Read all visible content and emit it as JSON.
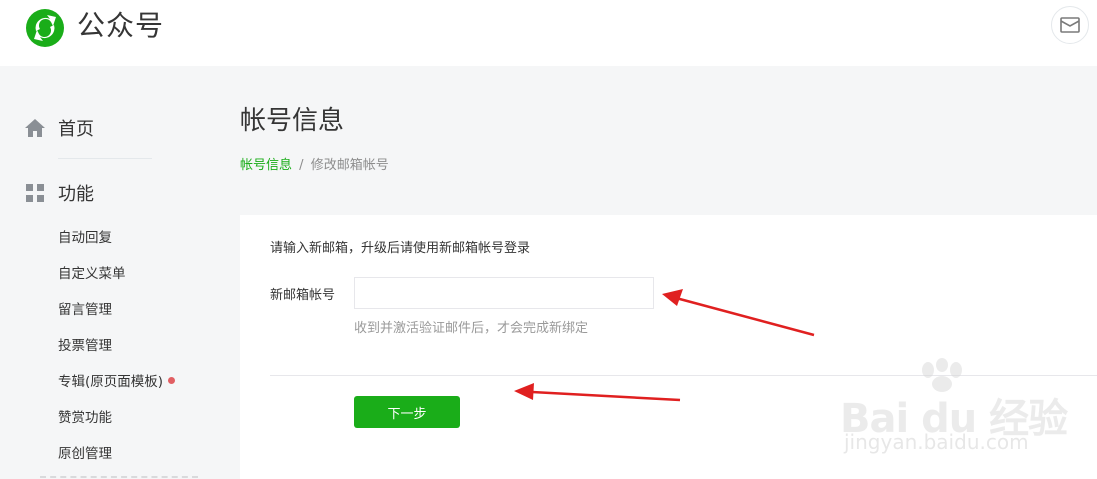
{
  "header": {
    "logo_text": "公众号",
    "mail_icon": "mail-icon"
  },
  "sidebar": {
    "home_label": "首页",
    "home_icon": "home-icon",
    "func_label": "功能",
    "func_icon": "grid-icon",
    "items": [
      {
        "label": "自动回复"
      },
      {
        "label": "自定义菜单"
      },
      {
        "label": "留言管理"
      },
      {
        "label": "投票管理"
      },
      {
        "label": "专辑(原页面模板)",
        "badge": "red-dot"
      },
      {
        "label": "赞赏功能"
      },
      {
        "label": "原创管理"
      }
    ]
  },
  "main": {
    "title": "帐号信息",
    "breadcrumb": {
      "link": "帐号信息",
      "separator": "/",
      "current": "修改邮箱帐号"
    },
    "form": {
      "instruction": "请输入新邮箱，升级后请使用新邮箱帐号登录",
      "email_label": "新邮箱帐号",
      "email_value": "",
      "hint": "收到并激活验证邮件后，才会完成新绑定",
      "next_button": "下一步"
    }
  },
  "watermark": {
    "brand": "Bai du 经验",
    "url": "jingyan.baidu.com"
  },
  "colors": {
    "accent": "#1aad19",
    "arrow": "#e02020",
    "background": "#f5f6f7"
  }
}
